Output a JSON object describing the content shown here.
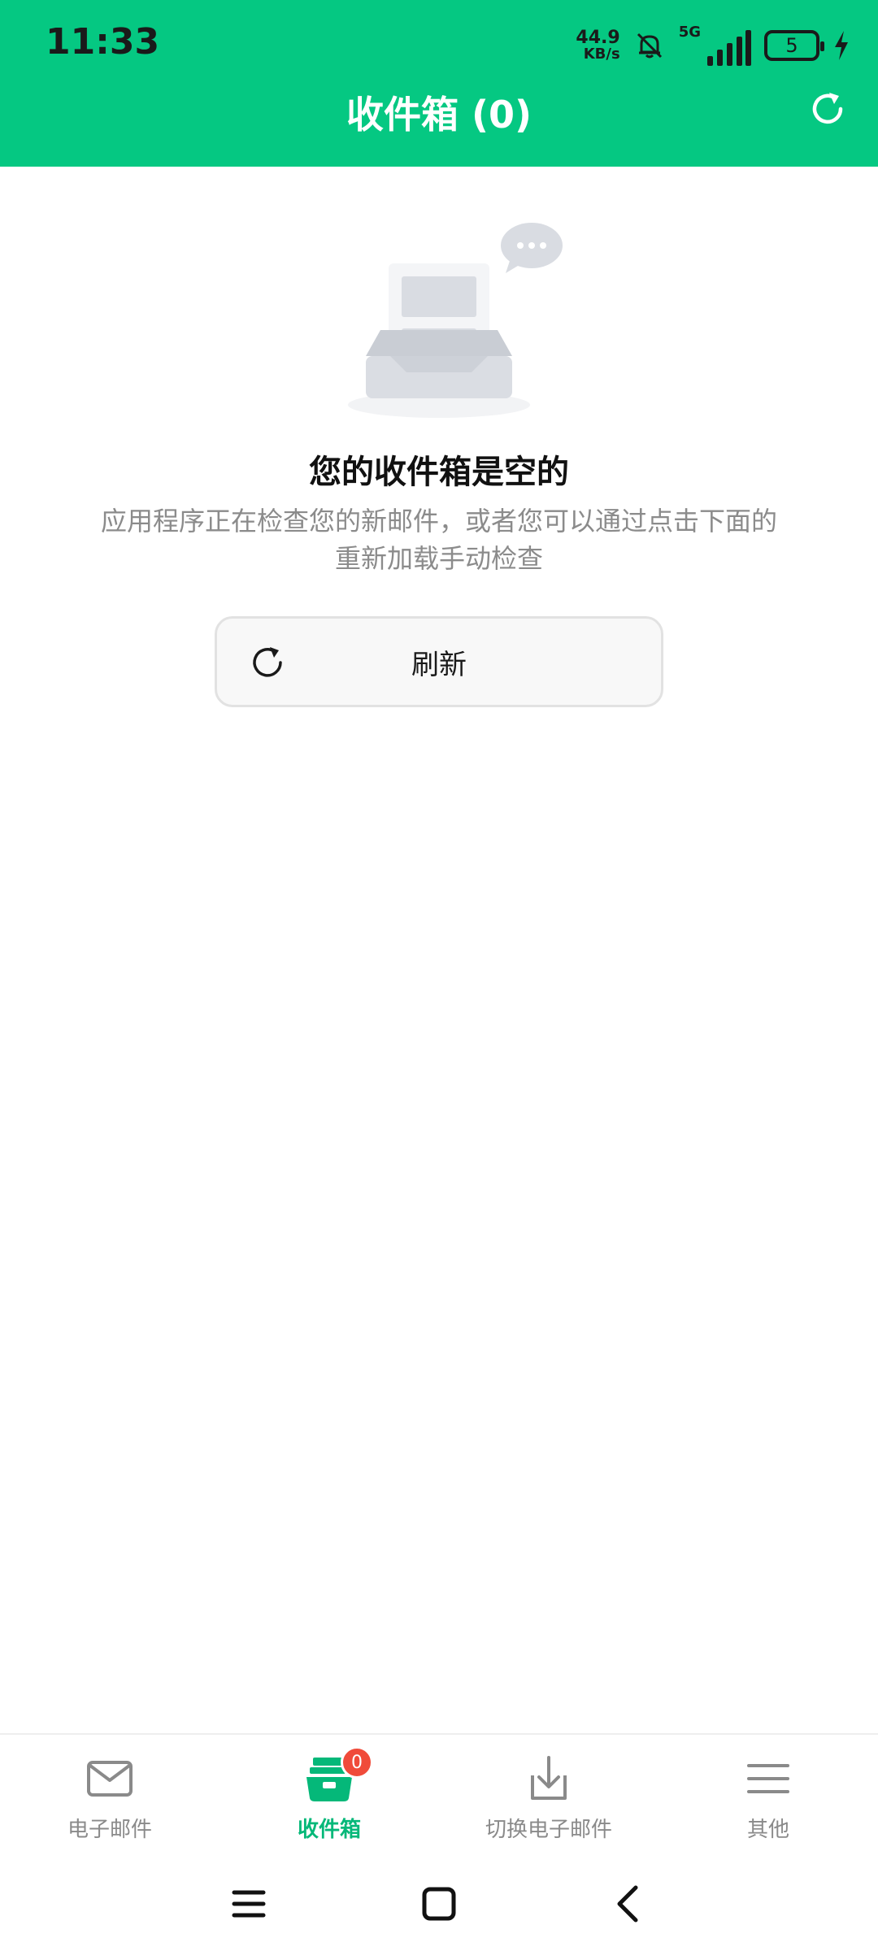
{
  "status_bar": {
    "time": "11:33",
    "net_speed_value": "44.9",
    "net_speed_unit": "KB/s",
    "signal_label": "5G",
    "battery_level": "5"
  },
  "header": {
    "title": "收件箱 (0)"
  },
  "empty_state": {
    "title": "您的收件箱是空的",
    "description": "应用程序正在检查您的新邮件，或者您可以通过点击下面的重新加载手动检查",
    "refresh_label": "刷新"
  },
  "bottom_nav": {
    "items": [
      {
        "label": "电子邮件"
      },
      {
        "label": "收件箱",
        "badge": "0"
      },
      {
        "label": "切换电子邮件"
      },
      {
        "label": "其他"
      }
    ]
  },
  "colors": {
    "primary": "#05C882",
    "active_tab": "#05B879",
    "badge": "#F04B3A"
  }
}
